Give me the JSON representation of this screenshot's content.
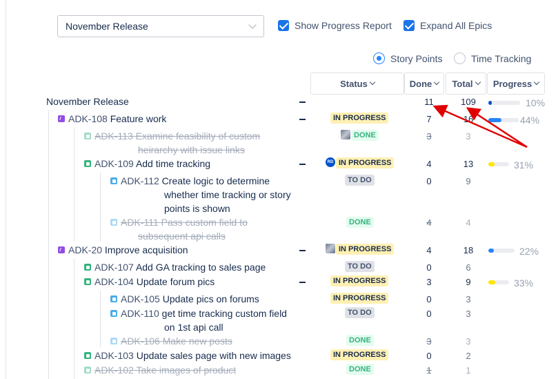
{
  "release_select": {
    "value": "November Release"
  },
  "options": {
    "show_progress_report": "Show Progress Report",
    "expand_all_epics": "Expand All Epics"
  },
  "estimation": {
    "story_points": "Story Points",
    "time_tracking": "Time Tracking",
    "selected": "Story Points"
  },
  "columns": {
    "status": "Status",
    "done": "Done",
    "total": "Total",
    "progress": "Progress"
  },
  "colors": {
    "accent": "#2684ff",
    "progress_blue": "#0052cc",
    "progress_yellow": "#ffe500",
    "in_progress_lozenge": "#fff0b3",
    "done_lozenge": "#e3fcef",
    "arrow": "#e00000"
  },
  "rows": [
    {
      "key": "",
      "title": "November Release",
      "type": "release",
      "status": "",
      "done": "11",
      "total": "109",
      "progress": 0.1,
      "progress_label": "10%"
    },
    {
      "key": "ADK-108",
      "title": "Feature work",
      "type": "epic-icon",
      "status": "IN PROGRESS",
      "done": "7",
      "total": "16",
      "progress": 0.44,
      "progress_label": "44%"
    },
    {
      "key": "ADK-113",
      "title": "Examine feasibility of custom",
      "title2": "heirarchy with issue links",
      "type": "story-icon",
      "status": "DONE",
      "done": "3",
      "total": "3"
    },
    {
      "key": "ADK-109",
      "title": "Add time tracking",
      "type": "story-icon",
      "status": "IN PROGRESS",
      "avatar": "RD",
      "done": "4",
      "total": "13",
      "progress": 0.31,
      "progress_label": "31%"
    },
    {
      "key": "ADK-112",
      "title": "Create logic to determine",
      "title2": "whether time tracking or story",
      "title3": "points is shown",
      "type": "subtask-icon",
      "status": "TO DO",
      "done": "0",
      "total": "9"
    },
    {
      "key": "ADK-111",
      "title": "Pass custom field to",
      "title2": "subsequent api calls",
      "type": "subtask-icon",
      "status": "DONE",
      "done": "4",
      "total": "4"
    },
    {
      "key": "ADK-20",
      "title": "Improve acquisition",
      "type": "epic-icon",
      "status": "IN PROGRESS",
      "done": "4",
      "total": "18",
      "progress": 0.22,
      "progress_label": "22%"
    },
    {
      "key": "ADK-107",
      "title": "Add GA tracking to sales page",
      "type": "story-icon",
      "status": "TO DO",
      "done": "0",
      "total": "6"
    },
    {
      "key": "ADK-104",
      "title": "Update forum pics",
      "type": "story-icon",
      "status": "IN PROGRESS",
      "done": "3",
      "total": "9",
      "progress": 0.33,
      "progress_label": "33%"
    },
    {
      "key": "ADK-105",
      "title": "Update pics on forums",
      "type": "subtask-icon",
      "status": "IN PROGRESS",
      "done": "0",
      "total": "3"
    },
    {
      "key": "ADK-110",
      "title": "get time tracking custom field",
      "title2": "on 1st api call",
      "type": "subtask-icon",
      "status": "TO DO",
      "done": "0",
      "total": "3"
    },
    {
      "key": "ADK-106",
      "title": "Make new posts",
      "type": "subtask-icon",
      "status": "DONE",
      "done": "3",
      "total": "3"
    },
    {
      "key": "ADK-103",
      "title": "Update sales page with new images",
      "type": "story-icon",
      "status": "IN PROGRESS",
      "done": "0",
      "total": "2"
    },
    {
      "key": "ADK-102",
      "title": "Take images of product",
      "type": "story-icon",
      "status": "DONE",
      "done": "1",
      "total": "1"
    }
  ]
}
